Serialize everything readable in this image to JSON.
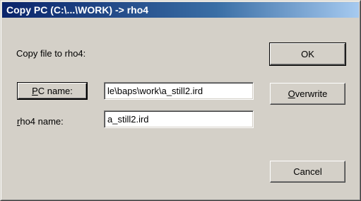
{
  "window": {
    "title": "Copy PC (C:\\...\\WORK) -> rho4"
  },
  "form": {
    "heading": "Copy file to rho4:",
    "pc_name_button": "PC name:",
    "pc_name_value": "le\\baps\\work\\a_still2.ird",
    "rho4_name_label": "rho4 name:",
    "rho4_name_value": "a_still2.ird"
  },
  "buttons": {
    "ok": "OK",
    "overwrite": "Overwrite",
    "cancel": "Cancel"
  },
  "colors": {
    "title_start": "#0a246a",
    "title_end": "#a6caf0",
    "dialog_bg": "#d4d0c8"
  }
}
